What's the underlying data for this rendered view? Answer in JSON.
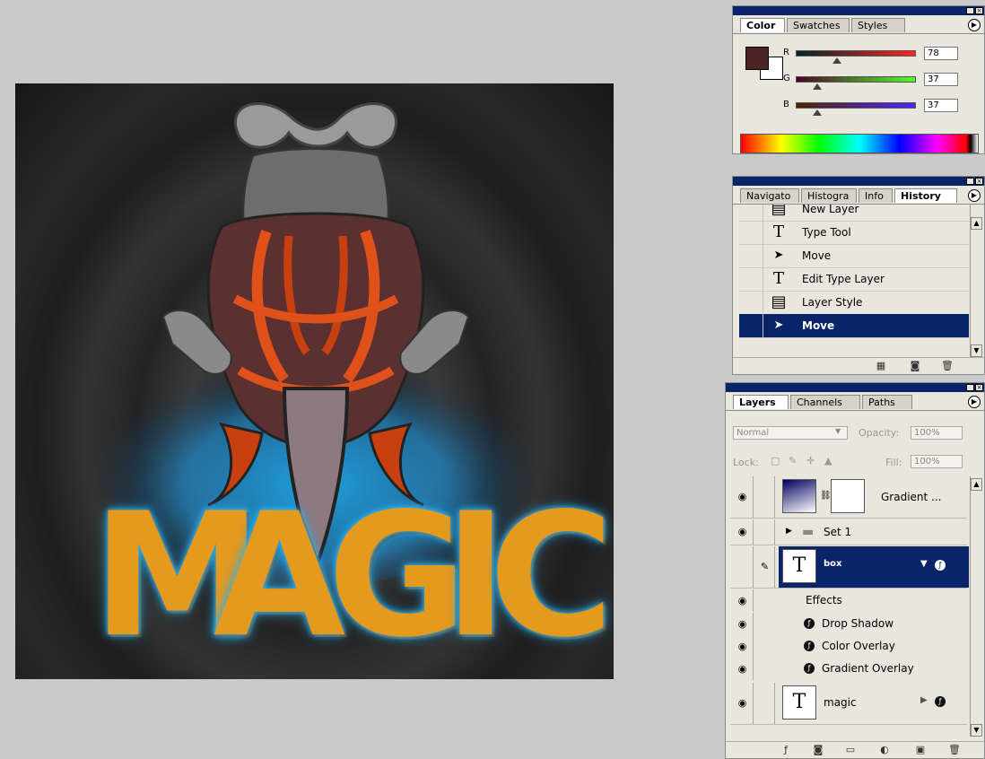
{
  "color_panel": {
    "tabs": [
      "Color",
      "Swatches",
      "Styles"
    ],
    "active_tab": "Color",
    "foreground_color": "#4e2525",
    "background_color": "#ffffff",
    "sliders": [
      {
        "label": "R",
        "value": "78",
        "fraction": 0.306
      },
      {
        "label": "G",
        "value": "37",
        "fraction": 0.145
      },
      {
        "label": "B",
        "value": "37",
        "fraction": 0.145
      }
    ]
  },
  "history_panel": {
    "tabs": [
      "Navigato",
      "Histogra",
      "Info",
      "History"
    ],
    "active_tab": "History",
    "items": [
      {
        "label": "New Layer",
        "icon": "document-icon",
        "glyph": "▤"
      },
      {
        "label": "Type Tool",
        "icon": "type-icon",
        "glyph": "T"
      },
      {
        "label": "Move",
        "icon": "move-icon",
        "glyph": "➤"
      },
      {
        "label": "Edit Type Layer",
        "icon": "type-icon",
        "glyph": "T"
      },
      {
        "label": "Layer Style",
        "icon": "document-icon",
        "glyph": "▤"
      },
      {
        "label": "Move",
        "icon": "move-icon",
        "glyph": "➤"
      }
    ],
    "selected_index": 5
  },
  "layers_panel": {
    "tabs": [
      "Layers",
      "Channels",
      "Paths"
    ],
    "active_tab": "Layers",
    "blend_mode": "Normal",
    "opacity_label": "Opacity:",
    "opacity_value": "100%",
    "lock_label": "Lock:",
    "fill_label": "Fill:",
    "fill_value": "100%",
    "layers": [
      {
        "name": "Gradient ...",
        "type": "adjustment"
      },
      {
        "name": "Set 1",
        "type": "folder"
      },
      {
        "name": "box",
        "type": "text",
        "selected": true
      },
      {
        "name": "magic",
        "type": "text"
      }
    ],
    "effects_label": "Effects",
    "effects": [
      "Drop Shadow",
      "Color Overlay",
      "Gradient Overlay"
    ]
  },
  "canvas": {
    "artwork_text": "MAGIC",
    "letter_color": "#e59a1e",
    "glow_color": "#1ea6e6"
  }
}
